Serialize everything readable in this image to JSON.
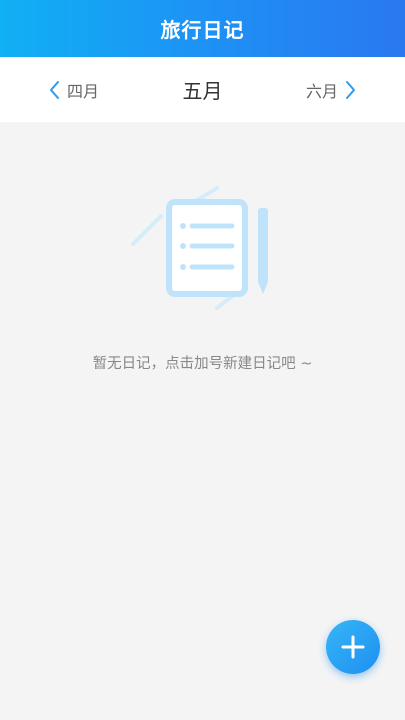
{
  "header": {
    "title": "旅行日记"
  },
  "month_nav": {
    "prev_label": "四月",
    "current_label": "五月",
    "next_label": "六月"
  },
  "empty_state": {
    "message": "暂无日记，点击加号新建日记吧 ~"
  },
  "icons": {
    "prev": "chevron-left-icon",
    "next": "chevron-right-icon",
    "empty": "notebook-pencil-icon",
    "add": "plus-icon"
  },
  "colors": {
    "header_gradient_start": "#10b0f4",
    "header_gradient_end": "#2a78f0",
    "accent": "#1e8ff0",
    "background": "#f4f4f4"
  }
}
